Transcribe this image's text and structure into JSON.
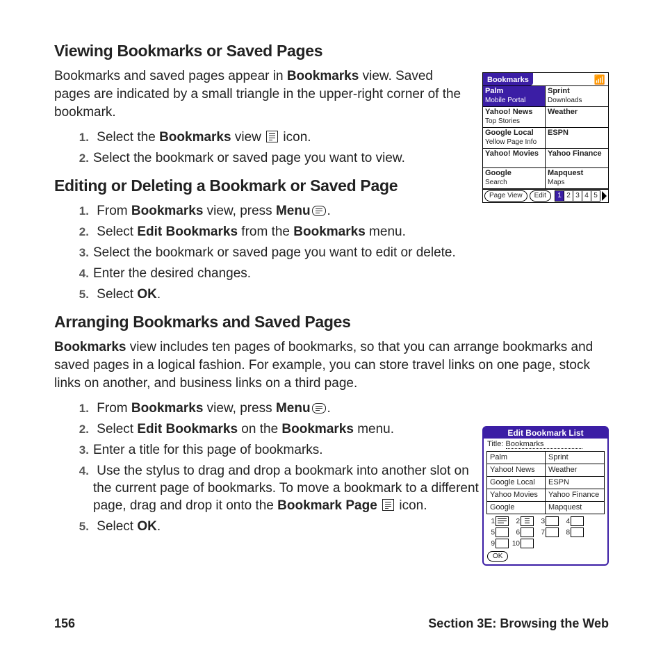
{
  "headings": {
    "h1": "Viewing Bookmarks or Saved Pages",
    "h2": "Editing or Deleting a Bookmark or Saved Page",
    "h3": "Arranging Bookmarks and Saved Pages"
  },
  "para": {
    "p1a": "Bookmarks and saved pages appear in ",
    "p1b": "Bookmarks",
    "p1c": " view. Saved pages are indicated by a small triangle in the upper-right corner of the bookmark.",
    "p3a": "Bookmarks",
    "p3b": " view includes ten pages of bookmarks, so that you can arrange bookmarks and saved pages in a logical fashion. For example, you can store travel links on one page, stock links on another, and business links on a third page."
  },
  "list1": {
    "i1a": "Select the ",
    "i1b": "Bookmarks",
    "i1c": " view ",
    "i1d": " icon.",
    "i2": "Select the bookmark or saved page you want to view."
  },
  "list2": {
    "i1a": "From ",
    "i1b": "Bookmarks",
    "i1c": " view, press ",
    "i1d": "Menu",
    "i1e": " .",
    "i2a": "Select ",
    "i2b": "Edit Bookmarks",
    "i2c": " from the ",
    "i2d": "Bookmarks",
    "i2e": " menu.",
    "i3": "Select the bookmark or saved page you want to edit or delete.",
    "i4": "Enter the desired changes.",
    "i5a": "Select ",
    "i5b": "OK",
    "i5c": "."
  },
  "list3": {
    "i1a": "From ",
    "i1b": "Bookmarks",
    "i1c": " view, press ",
    "i1d": "Menu",
    "i1e": " .",
    "i2a": "Select ",
    "i2b": "Edit Bookmarks",
    "i2c": " on the ",
    "i2d": "Bookmarks",
    "i2e": " menu.",
    "i3": "Enter a title for this page of bookmarks.",
    "i4a": "Use the stylus to drag and drop a bookmark into another slot on the current page of bookmarks. To move a bookmark to a different page, drag and drop it onto the ",
    "i4b": "Bookmark Page",
    "i4c": " icon.",
    "i5a": "Select ",
    "i5b": "OK",
    "i5c": "."
  },
  "fig1": {
    "title": "Bookmarks",
    "cells": [
      {
        "t1": "Palm",
        "t2": "Mobile Portal",
        "sel": true
      },
      {
        "t1": "Sprint",
        "t2": "Downloads"
      },
      {
        "t1": "Yahoo! News",
        "t2": "Top Stories"
      },
      {
        "t1": "Weather",
        "t2": ""
      },
      {
        "t1": "Google Local",
        "t2": "Yellow Page Info"
      },
      {
        "t1": "ESPN",
        "t2": ""
      },
      {
        "t1": "Yahoo! Movies",
        "t2": ""
      },
      {
        "t1": "Yahoo Finance",
        "t2": ""
      },
      {
        "t1": "Google",
        "t2": "Search"
      },
      {
        "t1": "Mapquest",
        "t2": "Maps"
      }
    ],
    "btn1": "Page View",
    "btn2": "Edit",
    "pages": [
      "1",
      "2",
      "3",
      "4",
      "5"
    ]
  },
  "fig2": {
    "title": "Edit Bookmark List",
    "field_label": "Title:",
    "field_value": "Bookmarks",
    "cells": [
      "Palm",
      "Sprint",
      "Yahoo! News",
      "Weather",
      "Google Local",
      "ESPN",
      "Yahoo Movies",
      "Yahoo Finance",
      "Google",
      "Mapquest"
    ],
    "pages": [
      "1",
      "2",
      "3",
      "4",
      "5",
      "6",
      "7",
      "8",
      "9",
      "10"
    ],
    "ok": "OK"
  },
  "footer": {
    "page": "156",
    "section": "Section 3E: Browsing the Web"
  }
}
